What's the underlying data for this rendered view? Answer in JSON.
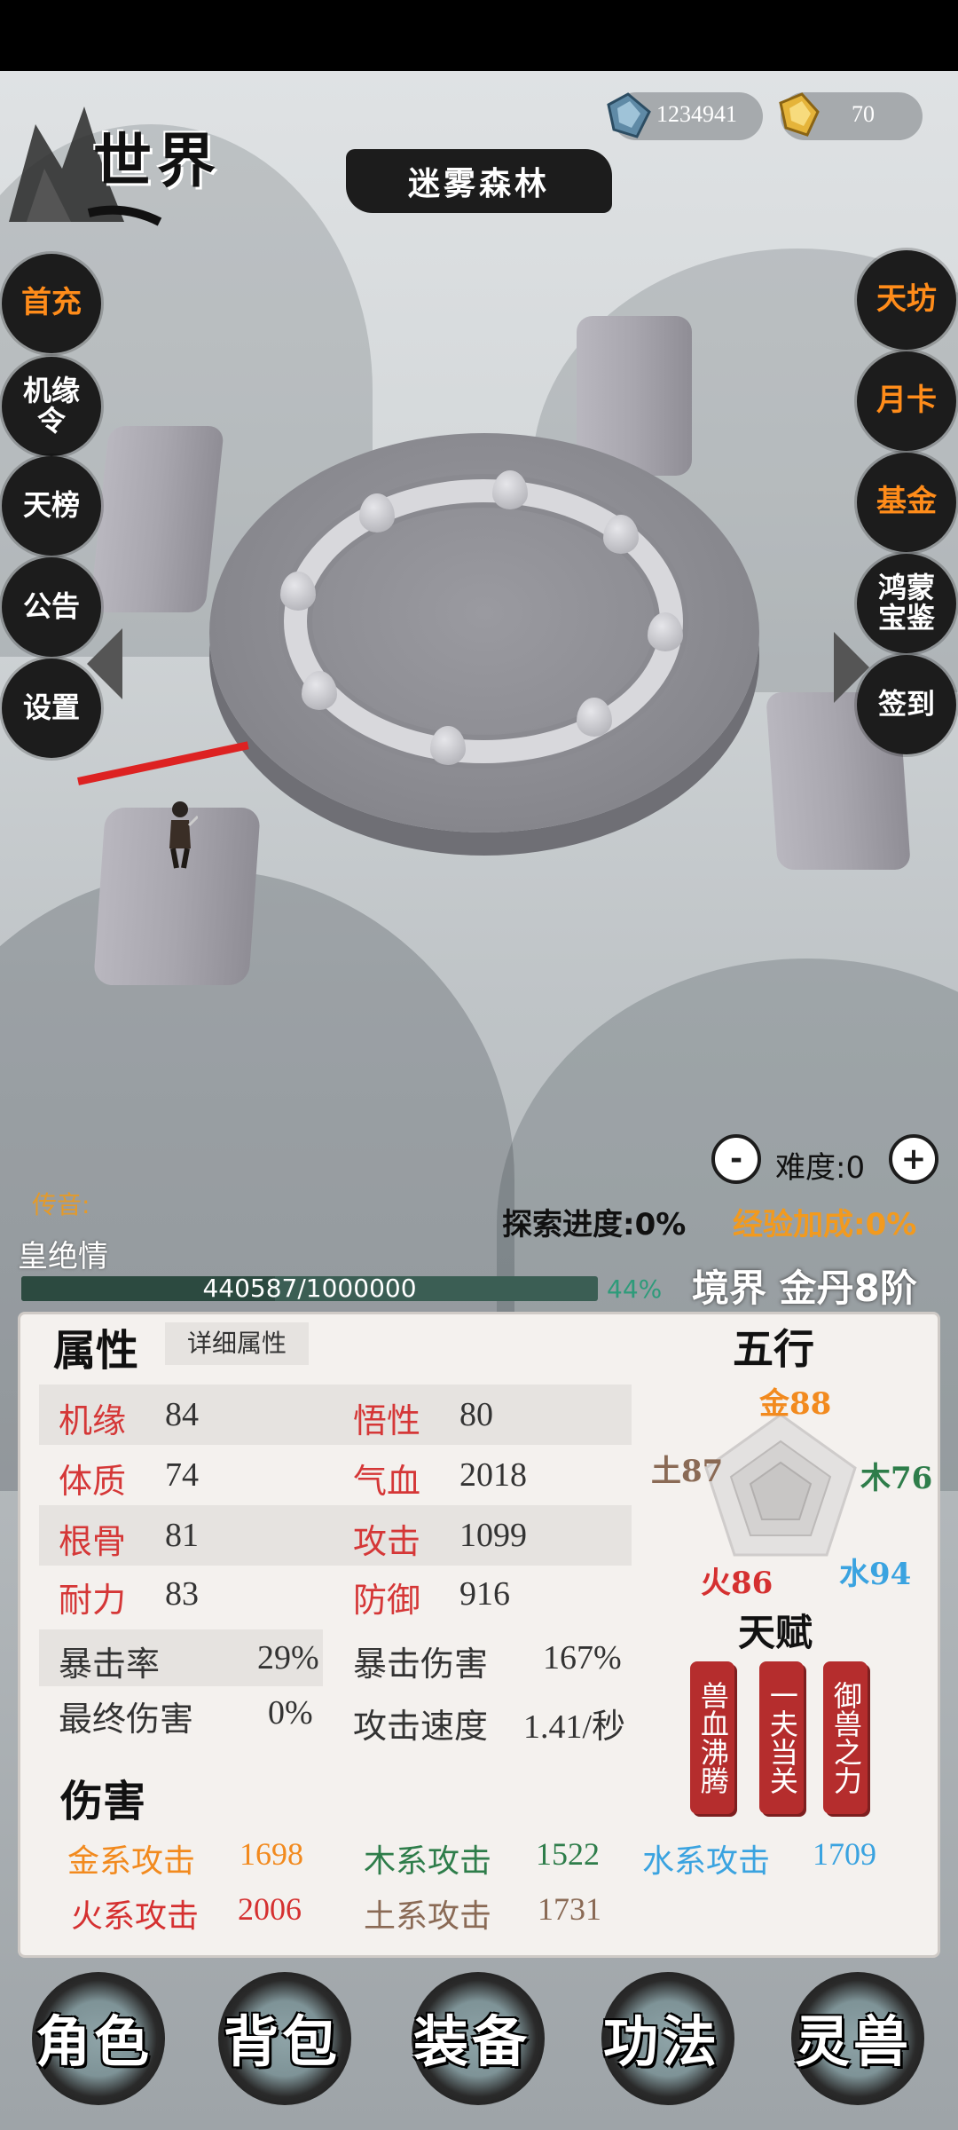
{
  "header": {
    "world_label": "世界",
    "location_title": "迷雾森林",
    "spirit_stones": "1234941",
    "gold_ingots": "70"
  },
  "left_menu": [
    "首充",
    "机缘令",
    "天榜",
    "公告",
    "设置"
  ],
  "right_menu": [
    "天坊",
    "月卡",
    "基金",
    "鸿蒙宝鉴",
    "签到"
  ],
  "difficulty": {
    "label": "难度:0",
    "minus": "-",
    "plus": "+"
  },
  "chuanyin": "传音:",
  "explore_progress": "探索进度:0%",
  "exp_bonus": "经验加成:0%",
  "player": {
    "name": "皇绝情",
    "exp_text": "440587/1000000",
    "exp_percent_text": "44%",
    "exp_fraction": 0.44,
    "realm": "境界 金丹8阶"
  },
  "attributes": {
    "title": "属性",
    "detail_tab": "详细属性",
    "rows": [
      {
        "l1": "机缘",
        "v1": "84",
        "l2": "悟性",
        "v2": "80"
      },
      {
        "l1": "体质",
        "v1": "74",
        "l2": "气血",
        "v2": "2018"
      },
      {
        "l1": "根骨",
        "v1": "81",
        "l2": "攻击",
        "v2": "1099"
      },
      {
        "l1": "耐力",
        "v1": "83",
        "l2": "防御",
        "v2": "916"
      }
    ],
    "crit_rate_label": "暴击率",
    "crit_rate": "29%",
    "crit_dmg_label": "暴击伤害",
    "crit_dmg": "167%",
    "final_dmg_label": "最终伤害",
    "final_dmg": "0%",
    "atk_speed_label": "攻击速度",
    "atk_speed": "1.41/秒"
  },
  "wuxing": {
    "title": "五行",
    "jin": "金88",
    "mu": "木76",
    "shui": "水94",
    "huo": "火86",
    "tu": "土87",
    "colors": {
      "jin": "#f28a1e",
      "mu": "#2e7d4a",
      "shui": "#3aa3e0",
      "huo": "#d53030",
      "tu": "#8a6a55"
    }
  },
  "talents": {
    "title": "天赋",
    "items": [
      "兽血沸腾",
      "一夫当关",
      "御兽之力"
    ]
  },
  "damage": {
    "title": "伤害",
    "items": [
      {
        "label": "金系攻击",
        "value": "1698",
        "color": "#f28a1e"
      },
      {
        "label": "木系攻击",
        "value": "1522",
        "color": "#2e7d4a"
      },
      {
        "label": "水系攻击",
        "value": "1709",
        "color": "#3aa3e0"
      },
      {
        "label": "火系攻击",
        "value": "2006",
        "color": "#d53030"
      },
      {
        "label": "土系攻击",
        "value": "1731",
        "color": "#8a6a55"
      }
    ]
  },
  "bottom_nav": [
    "角色",
    "背包",
    "装备",
    "功法",
    "灵兽"
  ]
}
